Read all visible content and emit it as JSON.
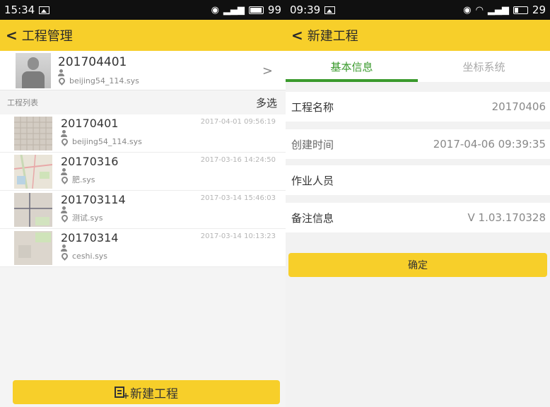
{
  "left": {
    "status": {
      "time": "15:34",
      "battery": "99"
    },
    "appbar": {
      "title": "工程管理"
    },
    "current": {
      "name": "201704401",
      "coord": "beijing54_114.sys"
    },
    "list_header": {
      "title": "工程列表",
      "multi_select": "多选"
    },
    "projects": [
      {
        "name": "20170401",
        "coord": "beijing54_114.sys",
        "date": "2017-04-01 09:56:19",
        "thumb": "grid"
      },
      {
        "name": "20170316",
        "coord": "肥.sys",
        "date": "2017-03-16 14:24:50",
        "thumb": "map"
      },
      {
        "name": "201703114",
        "coord": "测试.sys",
        "date": "2017-03-14 15:46:03",
        "thumb": "lines"
      },
      {
        "name": "20170314",
        "coord": "ceshi.sys",
        "date": "2017-03-14 10:13:23",
        "thumb": "map2"
      }
    ],
    "new_project_button": "新建工程"
  },
  "right": {
    "status": {
      "time": "09:39",
      "battery": "29"
    },
    "appbar": {
      "title": "新建工程"
    },
    "tabs": [
      {
        "label": "基本信息",
        "active": true
      },
      {
        "label": "坐标系统",
        "active": false
      }
    ],
    "form": [
      {
        "label": "工程名称",
        "value": "20170406"
      },
      {
        "label": "创建时间",
        "value": "2017-04-06 09:39:35"
      },
      {
        "label": "作业人员",
        "value": ""
      },
      {
        "label": "备注信息",
        "value": "V 1.03.170328"
      }
    ],
    "confirm_button": "确定"
  },
  "colors": {
    "accent": "#f7cf2a",
    "tab_active": "#3a9a2c"
  }
}
